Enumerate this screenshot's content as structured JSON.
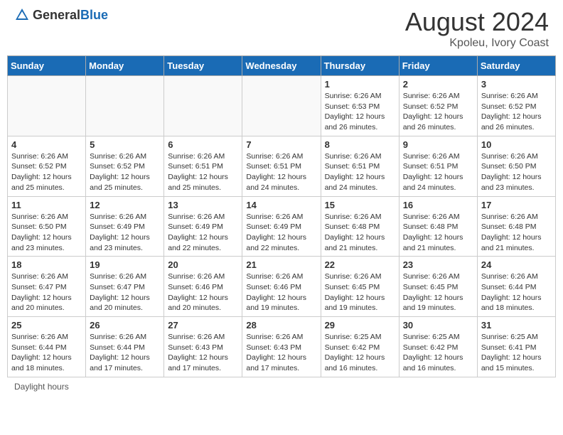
{
  "header": {
    "logo_general": "General",
    "logo_blue": "Blue",
    "month_year": "August 2024",
    "location": "Kpoleu, Ivory Coast"
  },
  "days_of_week": [
    "Sunday",
    "Monday",
    "Tuesday",
    "Wednesday",
    "Thursday",
    "Friday",
    "Saturday"
  ],
  "weeks": [
    [
      {
        "day": "",
        "info": ""
      },
      {
        "day": "",
        "info": ""
      },
      {
        "day": "",
        "info": ""
      },
      {
        "day": "",
        "info": ""
      },
      {
        "day": "1",
        "info": "Sunrise: 6:26 AM\nSunset: 6:53 PM\nDaylight: 12 hours and 26 minutes."
      },
      {
        "day": "2",
        "info": "Sunrise: 6:26 AM\nSunset: 6:52 PM\nDaylight: 12 hours and 26 minutes."
      },
      {
        "day": "3",
        "info": "Sunrise: 6:26 AM\nSunset: 6:52 PM\nDaylight: 12 hours and 26 minutes."
      }
    ],
    [
      {
        "day": "4",
        "info": "Sunrise: 6:26 AM\nSunset: 6:52 PM\nDaylight: 12 hours and 25 minutes."
      },
      {
        "day": "5",
        "info": "Sunrise: 6:26 AM\nSunset: 6:52 PM\nDaylight: 12 hours and 25 minutes."
      },
      {
        "day": "6",
        "info": "Sunrise: 6:26 AM\nSunset: 6:51 PM\nDaylight: 12 hours and 25 minutes."
      },
      {
        "day": "7",
        "info": "Sunrise: 6:26 AM\nSunset: 6:51 PM\nDaylight: 12 hours and 24 minutes."
      },
      {
        "day": "8",
        "info": "Sunrise: 6:26 AM\nSunset: 6:51 PM\nDaylight: 12 hours and 24 minutes."
      },
      {
        "day": "9",
        "info": "Sunrise: 6:26 AM\nSunset: 6:51 PM\nDaylight: 12 hours and 24 minutes."
      },
      {
        "day": "10",
        "info": "Sunrise: 6:26 AM\nSunset: 6:50 PM\nDaylight: 12 hours and 23 minutes."
      }
    ],
    [
      {
        "day": "11",
        "info": "Sunrise: 6:26 AM\nSunset: 6:50 PM\nDaylight: 12 hours and 23 minutes."
      },
      {
        "day": "12",
        "info": "Sunrise: 6:26 AM\nSunset: 6:49 PM\nDaylight: 12 hours and 23 minutes."
      },
      {
        "day": "13",
        "info": "Sunrise: 6:26 AM\nSunset: 6:49 PM\nDaylight: 12 hours and 22 minutes."
      },
      {
        "day": "14",
        "info": "Sunrise: 6:26 AM\nSunset: 6:49 PM\nDaylight: 12 hours and 22 minutes."
      },
      {
        "day": "15",
        "info": "Sunrise: 6:26 AM\nSunset: 6:48 PM\nDaylight: 12 hours and 21 minutes."
      },
      {
        "day": "16",
        "info": "Sunrise: 6:26 AM\nSunset: 6:48 PM\nDaylight: 12 hours and 21 minutes."
      },
      {
        "day": "17",
        "info": "Sunrise: 6:26 AM\nSunset: 6:48 PM\nDaylight: 12 hours and 21 minutes."
      }
    ],
    [
      {
        "day": "18",
        "info": "Sunrise: 6:26 AM\nSunset: 6:47 PM\nDaylight: 12 hours and 20 minutes."
      },
      {
        "day": "19",
        "info": "Sunrise: 6:26 AM\nSunset: 6:47 PM\nDaylight: 12 hours and 20 minutes."
      },
      {
        "day": "20",
        "info": "Sunrise: 6:26 AM\nSunset: 6:46 PM\nDaylight: 12 hours and 20 minutes."
      },
      {
        "day": "21",
        "info": "Sunrise: 6:26 AM\nSunset: 6:46 PM\nDaylight: 12 hours and 19 minutes."
      },
      {
        "day": "22",
        "info": "Sunrise: 6:26 AM\nSunset: 6:45 PM\nDaylight: 12 hours and 19 minutes."
      },
      {
        "day": "23",
        "info": "Sunrise: 6:26 AM\nSunset: 6:45 PM\nDaylight: 12 hours and 19 minutes."
      },
      {
        "day": "24",
        "info": "Sunrise: 6:26 AM\nSunset: 6:44 PM\nDaylight: 12 hours and 18 minutes."
      }
    ],
    [
      {
        "day": "25",
        "info": "Sunrise: 6:26 AM\nSunset: 6:44 PM\nDaylight: 12 hours and 18 minutes."
      },
      {
        "day": "26",
        "info": "Sunrise: 6:26 AM\nSunset: 6:44 PM\nDaylight: 12 hours and 17 minutes."
      },
      {
        "day": "27",
        "info": "Sunrise: 6:26 AM\nSunset: 6:43 PM\nDaylight: 12 hours and 17 minutes."
      },
      {
        "day": "28",
        "info": "Sunrise: 6:26 AM\nSunset: 6:43 PM\nDaylight: 12 hours and 17 minutes."
      },
      {
        "day": "29",
        "info": "Sunrise: 6:25 AM\nSunset: 6:42 PM\nDaylight: 12 hours and 16 minutes."
      },
      {
        "day": "30",
        "info": "Sunrise: 6:25 AM\nSunset: 6:42 PM\nDaylight: 12 hours and 16 minutes."
      },
      {
        "day": "31",
        "info": "Sunrise: 6:25 AM\nSunset: 6:41 PM\nDaylight: 12 hours and 15 minutes."
      }
    ]
  ],
  "footer": "Daylight hours"
}
